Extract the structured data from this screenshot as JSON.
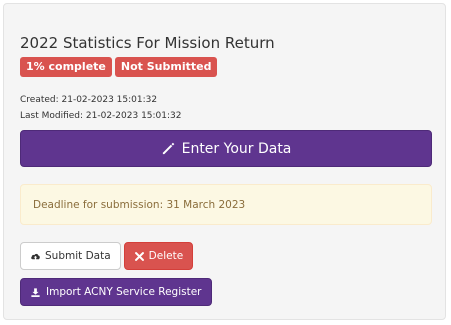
{
  "card": {
    "title": "2022 Statistics For Mission Return",
    "badges": {
      "progress": "1% complete",
      "status": "Not Submitted"
    },
    "created": "Created: 21-02-2023 15:01:32",
    "last_modified": "Last Modified: 21-02-2023 15:01:32"
  },
  "actions": {
    "enter_data_label": "Enter Your Data",
    "submit_label": "Submit Data",
    "delete_label": "Delete",
    "import_label": "Import ACNY Service Register"
  },
  "alert": {
    "deadline_text": "Deadline for submission: 31 March 2023"
  },
  "icons": {
    "enter": "pencil-icon",
    "submit": "cloud-upload-icon",
    "delete": "times-icon",
    "import": "import-icon"
  },
  "colors": {
    "primary_purple": "#5f358f",
    "danger_red": "#d9534f",
    "alert_bg": "#fcf8e3",
    "alert_text": "#8a6d3b"
  }
}
